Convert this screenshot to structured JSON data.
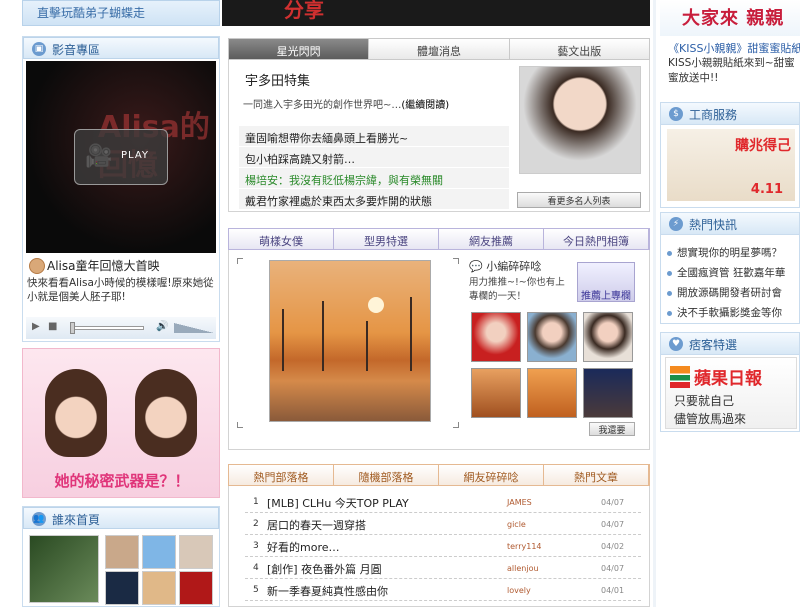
{
  "top": {
    "left_strip": "直擊玩酷弟子蝴蝶走",
    "dark_banner": "分享",
    "right_brand": "大家來 親親"
  },
  "kiss": {
    "title": "《KISS小親親》甜蜜蜜貼紙",
    "text": "KISS小親親貼紙來到~甜蜜蜜放送中!!"
  },
  "video_panel": {
    "heading": "影音專區",
    "ghost_text": "Alisa的回憶",
    "play_label": "PLAY",
    "caption_title": "Alisa童年回憶大首映",
    "caption_desc": "快來看看Alisa小時候的模樣喔!原來她從小就是個美人胚子耶!"
  },
  "pink_ad": {
    "slogan": "她的秘密武器是？！"
  },
  "who_panel": {
    "heading": "誰來首頁"
  },
  "tabs_top": {
    "t1": "星光閃閃",
    "t2": "體壇消息",
    "t3": "藝文出版"
  },
  "star": {
    "title": "宇多田特集",
    "intro_text": "一同進入宇多田光的創作世界吧~…",
    "intro_link": "(繼續閱讀)",
    "news": [
      "童固喻想帶你去緬鼻頭上看勝光~",
      "包小柏踩高蹺又射箭…",
      "楊培安：我沒有貶低楊宗緯，與有榮無關",
      "戴君竹家裡處於東西太多要炸開的狀態"
    ],
    "more_button": "看更多名人列表"
  },
  "tabs_mid": {
    "t1": "萌樣女僕",
    "t2": "型男特選",
    "t3": "網友推薦",
    "t4": "今日熱門相簿"
  },
  "mid": {
    "mini_head": "小編碎碎唸",
    "mini_text": "用力推推~!~你也有上專欄的一天！",
    "post_button": "推薦上專欄",
    "find_button": "我還要"
  },
  "tabs_bottom": {
    "t1": "熱門部落格",
    "t2": "隨機部落格",
    "t3": "網友碎碎唸",
    "t4": "熱門文章"
  },
  "articles": [
    {
      "n": "1",
      "title": "[MLB] CLHu 今天TOP PLAY",
      "user": "JAMES",
      "date": "04/07"
    },
    {
      "n": "2",
      "title": "居口的春天一週穿搭",
      "user": "gicle",
      "date": "04/07"
    },
    {
      "n": "3",
      "title": "好看的more…",
      "user": "terry114",
      "date": "04/02"
    },
    {
      "n": "4",
      "title": "[創作] 夜色番外篇 月圓",
      "user": "allenjou",
      "date": "04/07"
    },
    {
      "n": "5",
      "title": "新一季春夏純真性感由你",
      "user": "lovely",
      "date": "04/01"
    }
  ],
  "right": {
    "biz_heading": "工商服務",
    "biz_badge": "購兆得己",
    "biz_num": "4.11",
    "hot_heading": "熱門快訊",
    "hot_items": [
      "想實現你的明星夢嗎？",
      "全國瘋資管 狂歡嘉年華",
      "開放源碼開發者研討會",
      "決不手軟攝影獎金等你"
    ],
    "apple_heading": "痞客特選",
    "apple_brand": "蘋果日報",
    "apple_line1": "只要就自己",
    "apple_line2": "儘管放馬過來"
  },
  "colors": {
    "accent_blue": "#2c5f96",
    "tab_purple": "#5d54a3",
    "tab_orange": "#e07a1f",
    "pink": "#e0357a"
  }
}
